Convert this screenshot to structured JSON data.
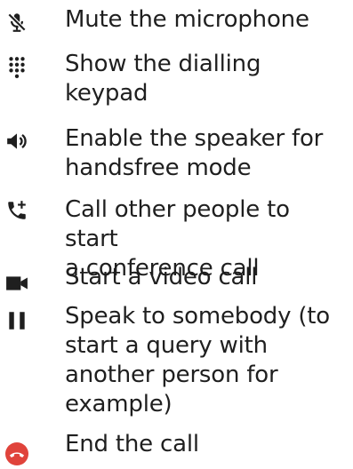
{
  "items": [
    {
      "icon": "microphone-muted-icon",
      "label": "Mute the microphone"
    },
    {
      "icon": "dialpad-icon",
      "label": "Show the dialling\nkeypad"
    },
    {
      "icon": "speaker-icon",
      "label": "Enable the speaker for\nhandsfree mode"
    },
    {
      "icon": "add-call-icon",
      "label": "Call other people to start\na conference call"
    },
    {
      "icon": "video-camera-icon",
      "label": "Start a video call"
    },
    {
      "icon": "pause-icon",
      "label": "Speak to somebody (to\nstart a query with\nanother person for\nexample)"
    },
    {
      "icon": "end-call-icon",
      "label": "End the call"
    }
  ],
  "colors": {
    "icon": "#1f1f1f",
    "end_call": "#e0433b",
    "text": "#1f1f1f"
  }
}
